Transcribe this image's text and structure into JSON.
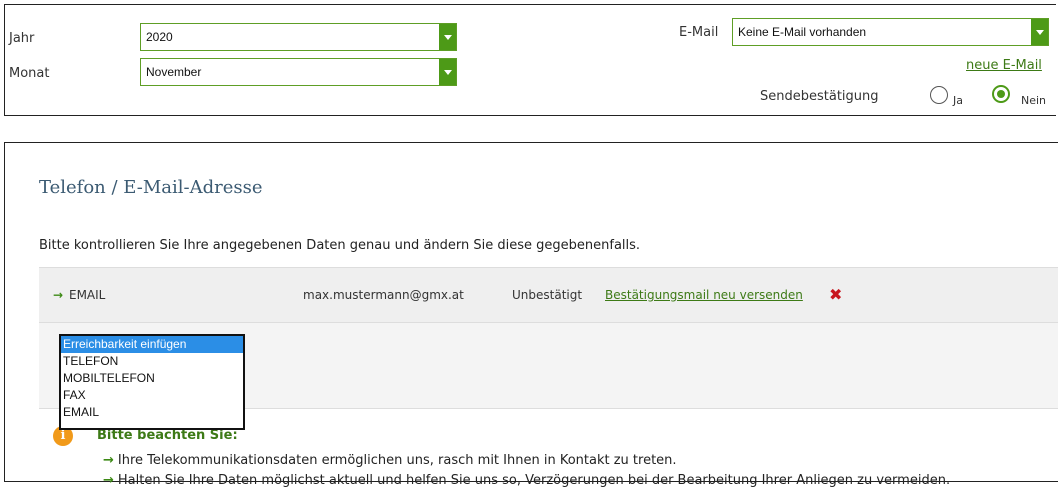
{
  "filters": {
    "year_label": "Jahr",
    "year_value": "2020",
    "month_label": "Monat",
    "month_value": "November",
    "email_label": "E-Mail",
    "email_value": "Keine E-Mail vorhanden",
    "new_email_link": "neue E-Mail",
    "send_confirmation_label": "Sendebestätigung",
    "radio_yes": "Ja",
    "radio_no": "Nein",
    "selected_radio": "Nein"
  },
  "contact": {
    "title": "Telefon / E-Mail-Adresse",
    "intro": "Bitte kontrollieren Sie Ihre angegebenen Daten genau und ändern Sie diese gegebenenfalls.",
    "entry": {
      "arrow": "→",
      "type": "EMAIL",
      "value": "max.mustermann@gmx.at",
      "status": "Unbestätigt",
      "resend_link": "Bestätigungsmail neu versenden",
      "delete_icon": "✖"
    },
    "add_dropdown": {
      "options": [
        "Erreichbarkeit einfügen",
        "TELEFON",
        "MOBILTELEFON",
        "FAX",
        "EMAIL"
      ],
      "selected_index": 0
    }
  },
  "notice": {
    "icon": "info-icon",
    "title": "Bitte beachten Sie:",
    "bullets": [
      "Ihre Telekommunikationsdaten ermöglichen uns, rasch mit Ihnen in Kontakt zu treten.",
      "Halten Sie Ihre Daten möglichst aktuell und helfen Sie uns so, Verzögerungen bei der Bearbeitung Ihrer Anliegen zu vermeiden."
    ]
  },
  "colors": {
    "accent_green": "#4d9a17",
    "link_green": "#3d7a16",
    "title_blue": "#3b5a72",
    "delete_red": "#c8161e",
    "info_orange": "#f19a1a",
    "selection_blue": "#2b8ee6"
  }
}
